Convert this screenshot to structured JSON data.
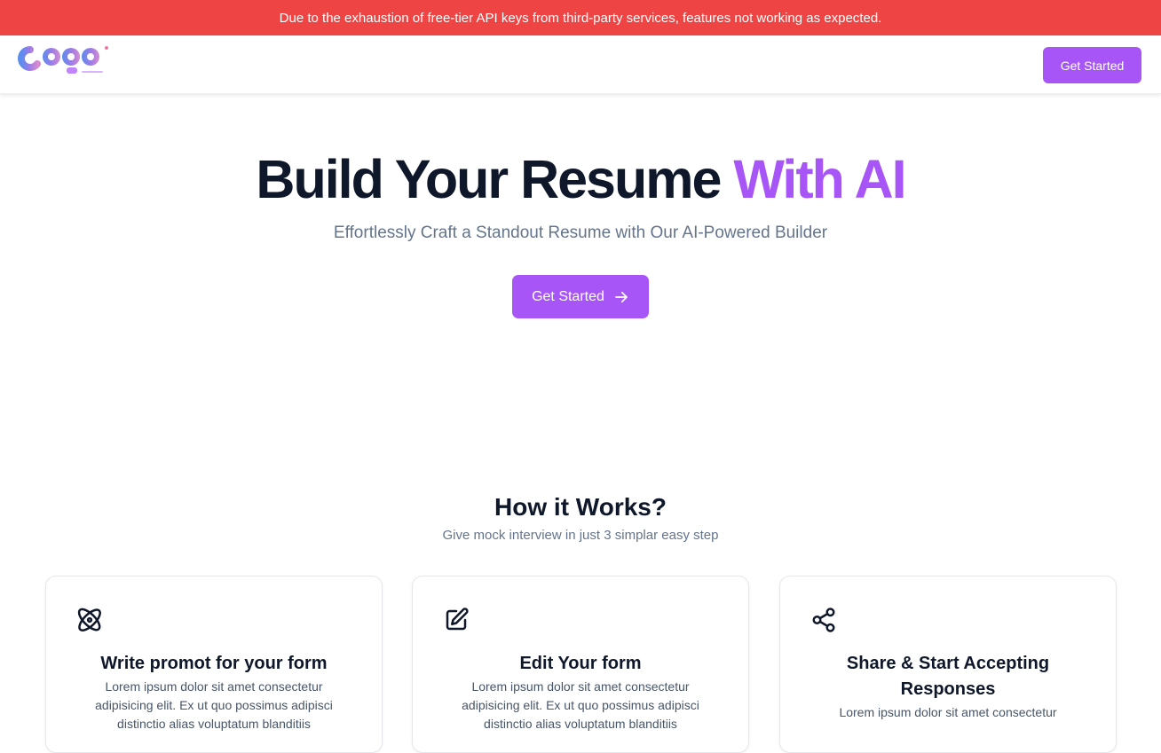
{
  "banner": {
    "text": "Due to the exhaustion of free-tier API keys from third-party services, features not working as expected."
  },
  "navbar": {
    "logo_name": "logo",
    "cta_label": "Get Started"
  },
  "hero": {
    "title_main": "Build Your Resume",
    "title_accent": "With AI",
    "subtitle": "Effortlessly Craft a Standout Resume with Our AI-Powered Builder",
    "cta_label": "Get Started",
    "cta_icon": "arrow-right-icon"
  },
  "how": {
    "title": "How it Works?",
    "subtitle": "Give mock interview in just 3 simplar easy step",
    "cards": [
      {
        "icon": "atom-icon",
        "title": "Write promot for your form",
        "text": "Lorem ipsum dolor sit amet consectetur adipisicing elit. Ex ut quo possimus adipisci distinctio alias voluptatum blanditiis"
      },
      {
        "icon": "edit-icon",
        "title": "Edit Your form",
        "text": "Lorem ipsum dolor sit amet consectetur adipisicing elit. Ex ut quo possimus adipisci distinctio alias voluptatum blanditiis"
      },
      {
        "icon": "share-icon",
        "title": "Share & Start Accepting Responses",
        "text": "Lorem ipsum dolor sit amet consectetur"
      }
    ]
  },
  "colors": {
    "banner": "#ef4444",
    "accent": "#a855f7",
    "heading": "#0f172a",
    "muted": "#64748b"
  }
}
